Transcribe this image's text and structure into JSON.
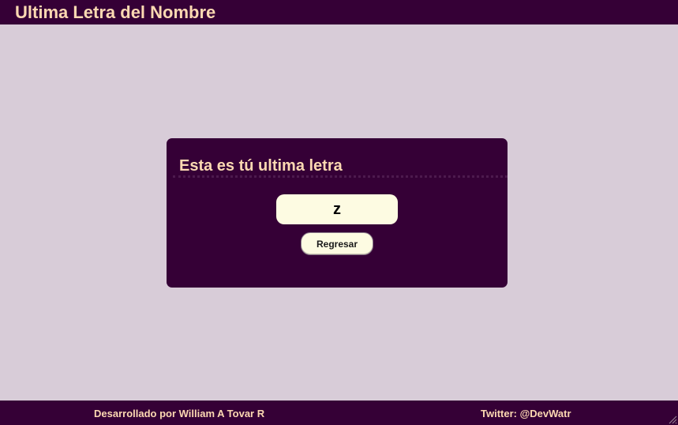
{
  "header": {
    "title": "Ultima Letra del Nombre"
  },
  "card": {
    "title": "Esta es tú ultima letra",
    "result_value": "z",
    "back_button_label": "Regresar"
  },
  "footer": {
    "credit": "Desarrollado por William A Tovar R",
    "twitter": "Twitter: @DevWatr"
  },
  "colors": {
    "page_background": "#d8ccd8",
    "bar_background": "#350036",
    "accent_text": "#fcd9b2",
    "field_background": "#fdfbe2"
  },
  "icons": {
    "resize": "resize-grip-icon"
  }
}
